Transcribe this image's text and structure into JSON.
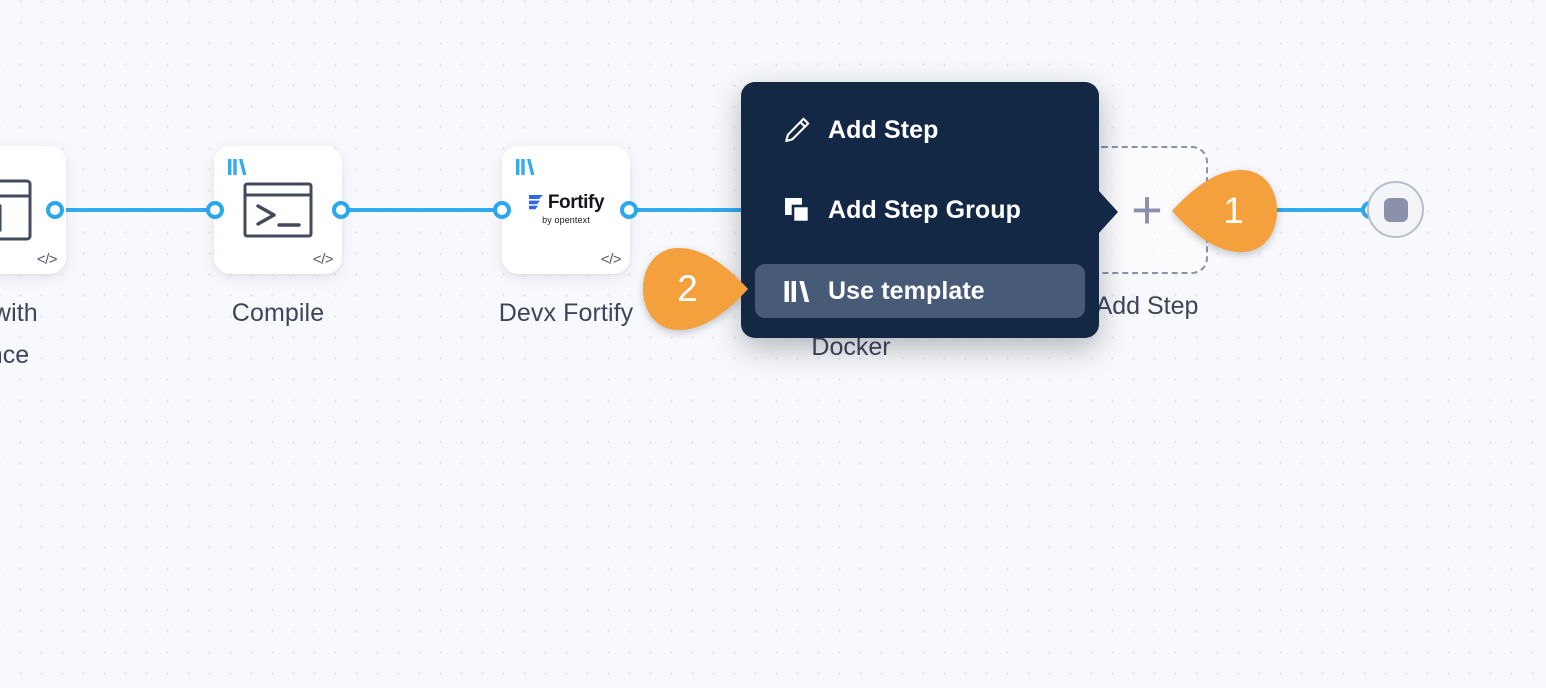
{
  "canvas": {
    "background_color": "#f8f9fc",
    "grid_dot_color": "#e0e3ec",
    "edge_color": "#32aaee"
  },
  "nodes": [
    {
      "id": "partial-left",
      "label": "ts with\nence",
      "icon": "browser-window-icon",
      "has_template_badge": false,
      "has_code_badge": true,
      "code_badge": "</>"
    },
    {
      "id": "compile",
      "label": "Compile",
      "icon": "terminal-icon",
      "has_template_badge": true,
      "has_code_badge": true,
      "code_badge": "</>"
    },
    {
      "id": "devx-fortify",
      "label": "Devx Fortify",
      "icon": "fortify-logo",
      "logo_title": "Fortify",
      "logo_subtitle": "by opentext",
      "has_template_badge": true,
      "has_code_badge": true,
      "code_badge": "</>"
    },
    {
      "id": "docker",
      "label": "Docker"
    },
    {
      "id": "add-step",
      "label": "Add Step",
      "plus": "+"
    }
  ],
  "end_node": {
    "name": "pipeline-end-node",
    "shape": "rounded-square",
    "color": "#8b90ab"
  },
  "context_menu": {
    "background_color": "#132845",
    "highlight_color": "#475a76",
    "items": [
      {
        "label": "Add Step",
        "icon": "pencil-icon",
        "highlighted": false
      },
      {
        "label": "Add Step Group",
        "icon": "stacked-squares-icon",
        "highlighted": false
      },
      {
        "label": "Use template",
        "icon": "template-books-icon",
        "highlighted": true
      }
    ]
  },
  "markers": [
    {
      "number": "1",
      "color": "#f4a03c",
      "direction": "left",
      "target": "add-step-node"
    },
    {
      "number": "2",
      "color": "#f4a03c",
      "direction": "right",
      "target": "use-template-menu-item"
    }
  ]
}
